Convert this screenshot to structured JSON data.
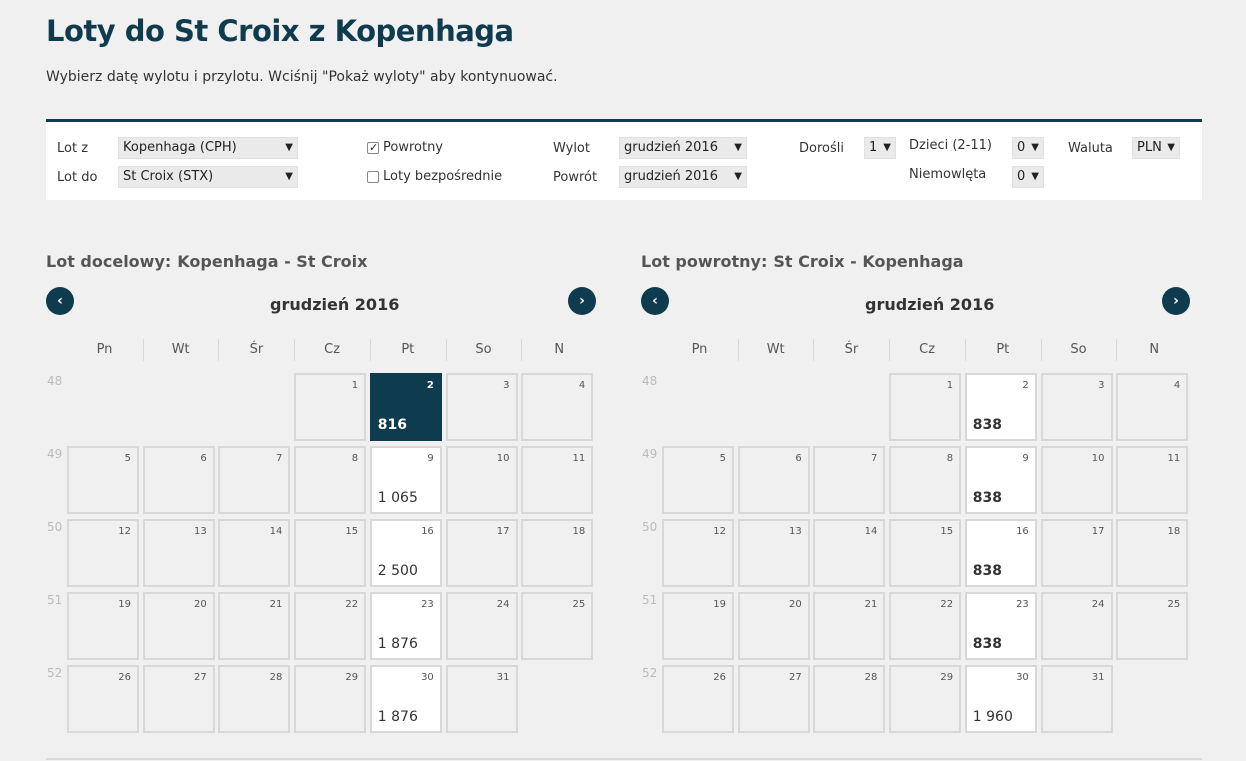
{
  "title": "Loty do St Croix z Kopenhaga",
  "subtitle": "Wybierz datę wylotu i przylotu. Wciśnij \"Pokaż wyloty\" aby kontynuować.",
  "form": {
    "from_label": "Lot z",
    "from_value": "Kopenhaga (CPH)",
    "to_label": "Lot do",
    "to_value": "St Croix (STX)",
    "return_label": "Powrotny",
    "return_checked": true,
    "direct_label": "Loty bezpośrednie",
    "direct_checked": false,
    "depart_label": "Wylot",
    "depart_value": "grudzień 2016",
    "return_date_label": "Powrót",
    "return_date_value": "grudzień 2016",
    "adults_label": "Dorośli",
    "adults_value": "1",
    "children_label": "Dzieci (2-11)",
    "children_value": "0",
    "infants_label": "Niemowlęta",
    "infants_value": "0",
    "currency_label": "Waluta",
    "currency_value": "PLN",
    "arrow_glyph": "▼"
  },
  "weekdays": [
    "Pn",
    "Wt",
    "Śr",
    "Cz",
    "Pt",
    "So",
    "N"
  ],
  "week_numbers": [
    "48",
    "49",
    "50",
    "51",
    "52"
  ],
  "outbound": {
    "label": "Lot docelowy:",
    "route": "Kopenhaga - St Croix",
    "month": "grudzień 2016",
    "prev_glyph": "‹",
    "next_glyph": "›",
    "days": [
      {
        "d": "1",
        "price": ""
      },
      {
        "d": "2",
        "price": "816",
        "selected": true
      },
      {
        "d": "3",
        "price": ""
      },
      {
        "d": "4",
        "price": ""
      },
      {
        "d": "5",
        "price": ""
      },
      {
        "d": "6",
        "price": ""
      },
      {
        "d": "7",
        "price": ""
      },
      {
        "d": "8",
        "price": ""
      },
      {
        "d": "9",
        "price": "1 065"
      },
      {
        "d": "10",
        "price": ""
      },
      {
        "d": "11",
        "price": ""
      },
      {
        "d": "12",
        "price": ""
      },
      {
        "d": "13",
        "price": ""
      },
      {
        "d": "14",
        "price": ""
      },
      {
        "d": "15",
        "price": ""
      },
      {
        "d": "16",
        "price": "2 500"
      },
      {
        "d": "17",
        "price": ""
      },
      {
        "d": "18",
        "price": ""
      },
      {
        "d": "19",
        "price": ""
      },
      {
        "d": "20",
        "price": ""
      },
      {
        "d": "21",
        "price": ""
      },
      {
        "d": "22",
        "price": ""
      },
      {
        "d": "23",
        "price": "1 876"
      },
      {
        "d": "24",
        "price": ""
      },
      {
        "d": "25",
        "price": ""
      },
      {
        "d": "26",
        "price": ""
      },
      {
        "d": "27",
        "price": ""
      },
      {
        "d": "28",
        "price": ""
      },
      {
        "d": "29",
        "price": ""
      },
      {
        "d": "30",
        "price": "1 876"
      },
      {
        "d": "31",
        "price": ""
      }
    ]
  },
  "inbound": {
    "label": "Lot powrotny:",
    "route": "St Croix - Kopenhaga",
    "month": "grudzień 2016",
    "prev_glyph": "‹",
    "next_glyph": "›",
    "days": [
      {
        "d": "1",
        "price": ""
      },
      {
        "d": "2",
        "price": "838",
        "bold": true
      },
      {
        "d": "3",
        "price": ""
      },
      {
        "d": "4",
        "price": ""
      },
      {
        "d": "5",
        "price": ""
      },
      {
        "d": "6",
        "price": ""
      },
      {
        "d": "7",
        "price": ""
      },
      {
        "d": "8",
        "price": ""
      },
      {
        "d": "9",
        "price": "838",
        "bold": true
      },
      {
        "d": "10",
        "price": ""
      },
      {
        "d": "11",
        "price": ""
      },
      {
        "d": "12",
        "price": ""
      },
      {
        "d": "13",
        "price": ""
      },
      {
        "d": "14",
        "price": ""
      },
      {
        "d": "15",
        "price": ""
      },
      {
        "d": "16",
        "price": "838",
        "bold": true
      },
      {
        "d": "17",
        "price": ""
      },
      {
        "d": "18",
        "price": ""
      },
      {
        "d": "19",
        "price": ""
      },
      {
        "d": "20",
        "price": ""
      },
      {
        "d": "21",
        "price": ""
      },
      {
        "d": "22",
        "price": ""
      },
      {
        "d": "23",
        "price": "838",
        "bold": true
      },
      {
        "d": "24",
        "price": ""
      },
      {
        "d": "25",
        "price": ""
      },
      {
        "d": "26",
        "price": ""
      },
      {
        "d": "27",
        "price": ""
      },
      {
        "d": "28",
        "price": ""
      },
      {
        "d": "29",
        "price": ""
      },
      {
        "d": "30",
        "price": "1 960"
      },
      {
        "d": "31",
        "price": ""
      }
    ]
  },
  "colors": {
    "accent": "#0e3b4d",
    "cell_border": "#d8d8d8",
    "background": "#f0f0f0"
  }
}
